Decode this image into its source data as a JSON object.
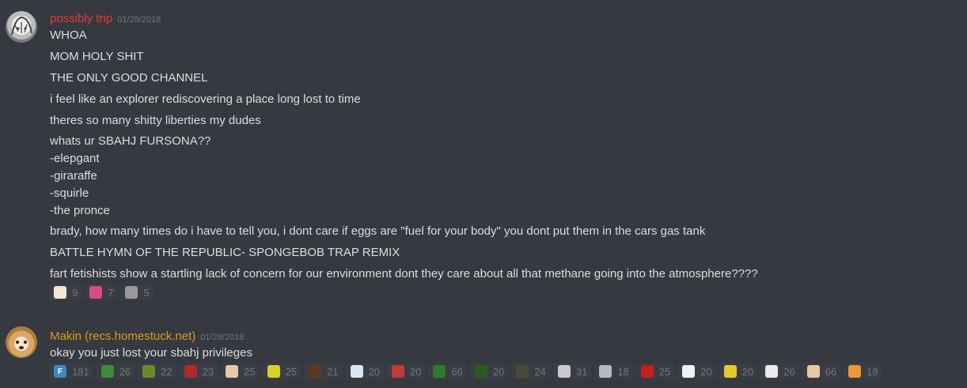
{
  "messages": [
    {
      "username": "possibly trip",
      "username_color": "#e23b3b",
      "timestamp": "01/28/2018",
      "avatar": "anime-character-avatar",
      "lines": [
        "WHOA",
        "MOM HOLY SHIT",
        "THE ONLY GOOD CHANNEL",
        "i feel like an explorer rediscovering a place long lost to time",
        "theres so many shitty liberties my dudes",
        "whats ur SBAHJ FURSONA??",
        "-elepgant",
        "-giraraffe",
        "-squirle",
        "-the pronce",
        "brady, how many times do i have to tell you, i dont care if eggs are \"fuel for your body\" you dont put them in the cars gas tank",
        "BATTLE HYMN OF THE REPUBLIC- SPONGEBOB TRAP REMIX",
        "fart fetishists show a startling lack of concern for our environment dont they care about all that methane going into the atmosphere????"
      ],
      "reactions": [
        {
          "icon": "clown-face-emoji",
          "count": "9",
          "color": "#f1e6d8"
        },
        {
          "icon": "pink-blob-emoji",
          "count": "7",
          "color": "#d94a8a"
        },
        {
          "icon": "black-white-sticker-emoji",
          "count": "5",
          "color": "#9a9a9a"
        }
      ]
    },
    {
      "username": "Makin (recs.homestuck.net)",
      "username_color": "#e09a1f",
      "timestamp": "01/28/2018",
      "avatar": "dog-photo-avatar",
      "lines": [
        "okay you just lost your sbahj privileges"
      ],
      "reactions": [
        {
          "icon": "f-letter-emoji",
          "count": "181",
          "color": "#3b88c3",
          "glyph": "F"
        },
        {
          "icon": "green-pixel-emoji",
          "count": "26",
          "color": "#3f8a3a"
        },
        {
          "icon": "green-troll-emoji",
          "count": "22",
          "color": "#6a8a2a"
        },
        {
          "icon": "red-pixel-emoji",
          "count": "23",
          "color": "#b02a2a"
        },
        {
          "icon": "face-sticker-emoji",
          "count": "25",
          "color": "#e5c9a8"
        },
        {
          "icon": "yellow-square-emoji",
          "count": "25",
          "color": "#d9cf2a"
        },
        {
          "icon": "brown-pixel-emoji",
          "count": "21",
          "color": "#5b3a1e"
        },
        {
          "icon": "blue-white-emoji",
          "count": "20",
          "color": "#dbe6f5"
        },
        {
          "icon": "red-cap-emoji",
          "count": "20",
          "color": "#c23a3a"
        },
        {
          "icon": "green-fish-emoji",
          "count": "66",
          "color": "#2e7a2e"
        },
        {
          "icon": "green-frog-emoji",
          "count": "20",
          "color": "#2d5a20"
        },
        {
          "icon": "dark-sketch-emoji",
          "count": "24",
          "color": "#4a4a3a"
        },
        {
          "icon": "white-figure-emoji",
          "count": "31",
          "color": "#c9c9c9"
        },
        {
          "icon": "cat-face-emoji",
          "count": "18",
          "color": "#b8b8c8"
        },
        {
          "icon": "red-scribble-emoji",
          "count": "25",
          "color": "#c21f1f"
        },
        {
          "icon": "white-face-emoji",
          "count": "20",
          "color": "#f0f0f0"
        },
        {
          "icon": "yellow-drawing-emoji",
          "count": "20",
          "color": "#e8c830"
        },
        {
          "icon": "troll-face-emoji",
          "count": "26",
          "color": "#eaeaea"
        },
        {
          "icon": "face-sticker-2-emoji",
          "count": "66",
          "color": "#e5c9a8"
        },
        {
          "icon": "cat-orange-emoji",
          "count": "18",
          "color": "#e89a3a"
        }
      ]
    }
  ]
}
